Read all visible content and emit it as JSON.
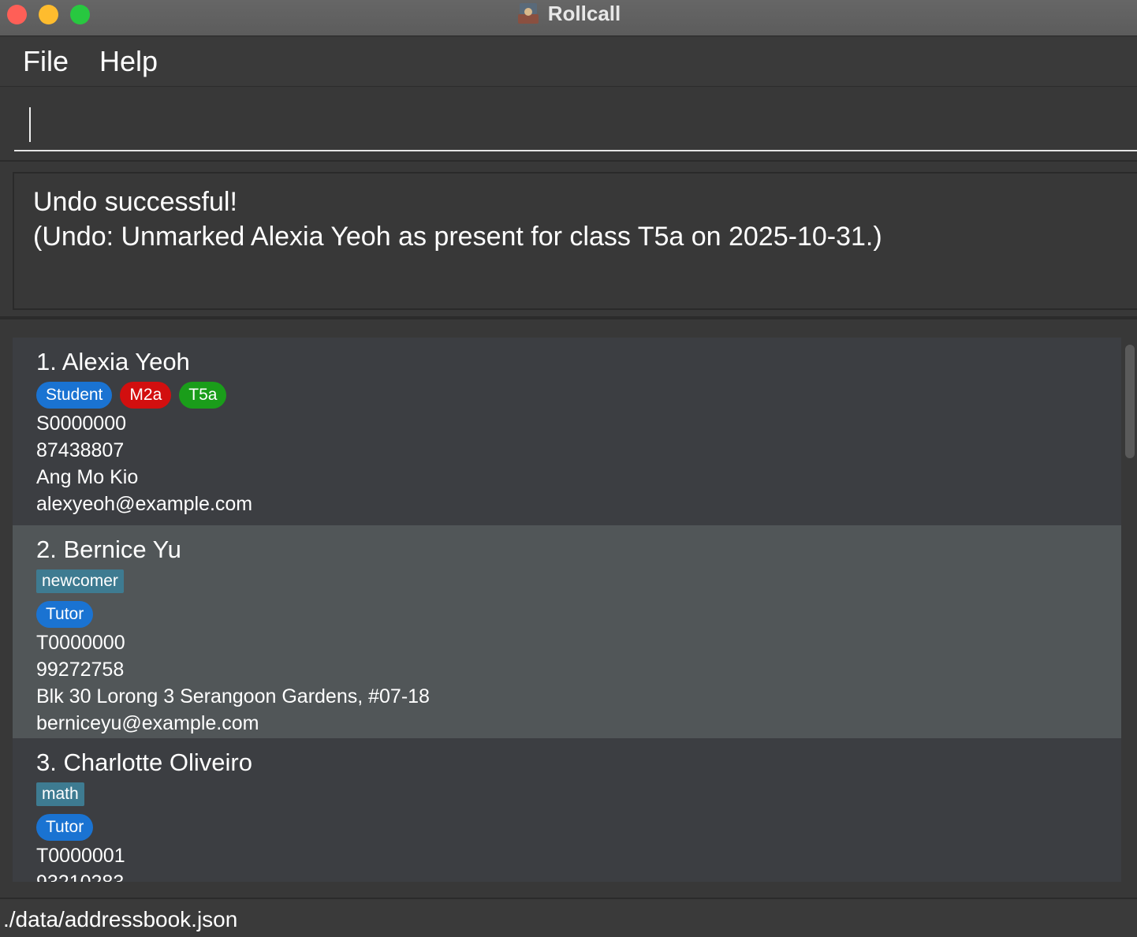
{
  "window": {
    "title": "Rollcall",
    "icon": "rollcall-app-icon"
  },
  "menu": {
    "file": "File",
    "help": "Help"
  },
  "command": {
    "value": "",
    "placeholder": ""
  },
  "result": {
    "line1": "Undo successful!",
    "line2": "(Undo: Unmarked Alexia Yeoh as present for class T5a on 2025-10-31.)"
  },
  "persons": [
    {
      "name": "1. Alexia Yeoh",
      "tags": [],
      "roles": [
        {
          "label": "Student",
          "color": "#1a73d2"
        },
        {
          "label": "M2a",
          "color": "#d20f0f"
        },
        {
          "label": "T5a",
          "color": "#1a9d1a"
        }
      ],
      "id": "S0000000",
      "phone": "87438807",
      "address": "Ang Mo Kio",
      "email": "alexyeoh@example.com"
    },
    {
      "name": "2. Bernice Yu",
      "tags": [
        "newcomer"
      ],
      "roles": [
        {
          "label": "Tutor",
          "color": "#1a73d2"
        }
      ],
      "id": "T0000000",
      "phone": "99272758",
      "address": "Blk 30 Lorong 3 Serangoon Gardens, #07-18",
      "email": "berniceyu@example.com"
    },
    {
      "name": "3. Charlotte Oliveiro",
      "tags": [
        "math"
      ],
      "roles": [
        {
          "label": "Tutor",
          "color": "#1a73d2"
        }
      ],
      "id": "T0000001",
      "phone": "93210283"
    }
  ],
  "status": {
    "path": "./data/addressbook.json"
  }
}
